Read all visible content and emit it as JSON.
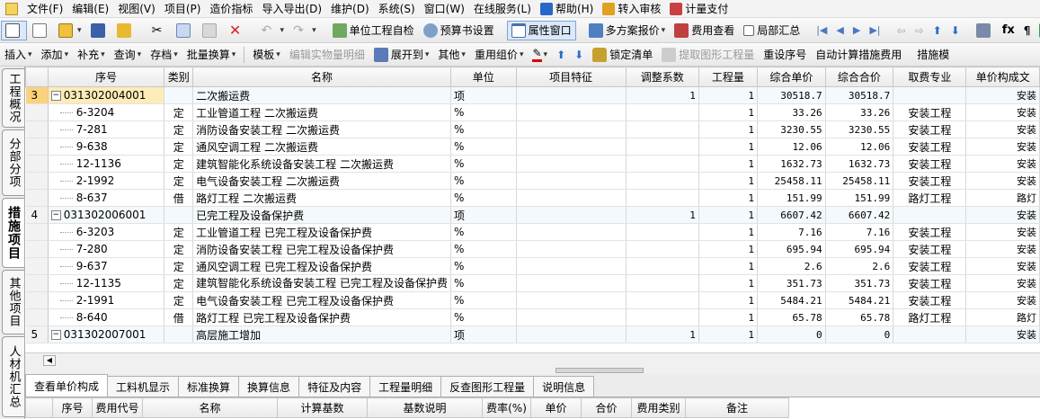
{
  "menu": [
    {
      "label": "文件(F)"
    },
    {
      "label": "编辑(E)"
    },
    {
      "label": "视图(V)"
    },
    {
      "label": "项目(P)"
    },
    {
      "label": "造价指标"
    },
    {
      "label": "导入导出(D)"
    },
    {
      "label": "维护(D)"
    },
    {
      "label": "系统(S)"
    },
    {
      "label": "窗口(W)"
    },
    {
      "label": "在线服务(L)"
    },
    {
      "label": "帮助(H)",
      "icon": "help-icon"
    },
    {
      "label": "转入审核",
      "icon": "audit-icon"
    },
    {
      "label": "计量支付",
      "icon": "pay-icon"
    }
  ],
  "toolbar1": {
    "self_check": "单位工程自检",
    "budget_settings": "预算书设置",
    "property_window": "属性窗口",
    "multi_quote": "多方案报价",
    "fee_view": "费用查看",
    "local_summary": "局部汇总"
  },
  "toolbar2": {
    "insert": "插入",
    "add": "添加",
    "supplement": "补充",
    "query": "查询",
    "archive": "存档",
    "batch_convert": "批量换算",
    "template": "模板",
    "edit_quantity_detail": "编辑实物量明细",
    "expand_to": "展开到",
    "other": "其他",
    "reuse_price": "重用组价",
    "lock_list": "锁定清单",
    "extract_graphic": "提取图形工程量",
    "reset_seq": "重设序号",
    "auto_calc_measure": "自动计算措施费用",
    "measure_template": "措施模"
  },
  "left_tabs": [
    "工程概况",
    "分部分项",
    "措施项目",
    "其他项目",
    "人材机汇总"
  ],
  "grid": {
    "columns": [
      "序号",
      "类别",
      "名称",
      "单位",
      "项目特征",
      "调整系数",
      "工程量",
      "综合单价",
      "综合合价",
      "取费专业",
      "单价构成文"
    ],
    "rows": [
      {
        "rn": "3",
        "code": "031302004001",
        "cat": "",
        "name": "二次搬运费",
        "unit": "项",
        "feature": "",
        "coef": "1",
        "qty": "1",
        "uprice": "30518.7",
        "total": "30518.7",
        "spec": "",
        "comp": "安装",
        "head": true,
        "sel": true
      },
      {
        "rn": "",
        "code": "6-3204",
        "cat": "定",
        "name": "工业管道工程 二次搬运费",
        "unit": "%",
        "feature": "",
        "coef": "",
        "qty": "1",
        "uprice": "33.26",
        "total": "33.26",
        "spec": "安装工程",
        "comp": "安装"
      },
      {
        "rn": "",
        "code": "7-281",
        "cat": "定",
        "name": "消防设备安装工程 二次搬运费",
        "unit": "%",
        "feature": "",
        "coef": "",
        "qty": "1",
        "uprice": "3230.55",
        "total": "3230.55",
        "spec": "安装工程",
        "comp": "安装"
      },
      {
        "rn": "",
        "code": "9-638",
        "cat": "定",
        "name": "通风空调工程 二次搬运费",
        "unit": "%",
        "feature": "",
        "coef": "",
        "qty": "1",
        "uprice": "12.06",
        "total": "12.06",
        "spec": "安装工程",
        "comp": "安装"
      },
      {
        "rn": "",
        "code": "12-1136",
        "cat": "定",
        "name": "建筑智能化系统设备安装工程 二次搬运费",
        "unit": "%",
        "feature": "",
        "coef": "",
        "qty": "1",
        "uprice": "1632.73",
        "total": "1632.73",
        "spec": "安装工程",
        "comp": "安装"
      },
      {
        "rn": "",
        "code": "2-1992",
        "cat": "定",
        "name": "电气设备安装工程 二次搬运费",
        "unit": "%",
        "feature": "",
        "coef": "",
        "qty": "1",
        "uprice": "25458.11",
        "total": "25458.11",
        "spec": "安装工程",
        "comp": "安装"
      },
      {
        "rn": "",
        "code": "8-637",
        "cat": "借",
        "name": "路灯工程 二次搬运费",
        "unit": "%",
        "feature": "",
        "coef": "",
        "qty": "1",
        "uprice": "151.99",
        "total": "151.99",
        "spec": "路灯工程",
        "comp": "路灯"
      },
      {
        "rn": "4",
        "code": "031302006001",
        "cat": "",
        "name": "已完工程及设备保护费",
        "unit": "项",
        "feature": "",
        "coef": "1",
        "qty": "1",
        "uprice": "6607.42",
        "total": "6607.42",
        "spec": "",
        "comp": "安装",
        "head": true
      },
      {
        "rn": "",
        "code": "6-3203",
        "cat": "定",
        "name": "工业管道工程 已完工程及设备保护费",
        "unit": "%",
        "feature": "",
        "coef": "",
        "qty": "1",
        "uprice": "7.16",
        "total": "7.16",
        "spec": "安装工程",
        "comp": "安装"
      },
      {
        "rn": "",
        "code": "7-280",
        "cat": "定",
        "name": "消防设备安装工程 已完工程及设备保护费",
        "unit": "%",
        "feature": "",
        "coef": "",
        "qty": "1",
        "uprice": "695.94",
        "total": "695.94",
        "spec": "安装工程",
        "comp": "安装"
      },
      {
        "rn": "",
        "code": "9-637",
        "cat": "定",
        "name": "通风空调工程 已完工程及设备保护费",
        "unit": "%",
        "feature": "",
        "coef": "",
        "qty": "1",
        "uprice": "2.6",
        "total": "2.6",
        "spec": "安装工程",
        "comp": "安装"
      },
      {
        "rn": "",
        "code": "12-1135",
        "cat": "定",
        "name": "建筑智能化系统设备安装工程 已完工程及设备保护费",
        "unit": "%",
        "feature": "",
        "coef": "",
        "qty": "1",
        "uprice": "351.73",
        "total": "351.73",
        "spec": "安装工程",
        "comp": "安装",
        "wrap": true
      },
      {
        "rn": "",
        "code": "2-1991",
        "cat": "定",
        "name": "电气设备安装工程 已完工程及设备保护费",
        "unit": "%",
        "feature": "",
        "coef": "",
        "qty": "1",
        "uprice": "5484.21",
        "total": "5484.21",
        "spec": "安装工程",
        "comp": "安装"
      },
      {
        "rn": "",
        "code": "8-640",
        "cat": "借",
        "name": "路灯工程 已完工程及设备保护费",
        "unit": "%",
        "feature": "",
        "coef": "",
        "qty": "1",
        "uprice": "65.78",
        "total": "65.78",
        "spec": "路灯工程",
        "comp": "路灯"
      },
      {
        "rn": "5",
        "code": "031302007001",
        "cat": "",
        "name": "高层施工增加",
        "unit": "项",
        "feature": "",
        "coef": "1",
        "qty": "1",
        "uprice": "0",
        "total": "0",
        "spec": "",
        "comp": "安装",
        "head": true
      }
    ]
  },
  "bottom_tabs": [
    "查看单价构成",
    "工料机显示",
    "标准换算",
    "换算信息",
    "特征及内容",
    "工程量明细",
    "反查图形工程量",
    "说明信息"
  ],
  "bottom_grid": {
    "columns": [
      "序号",
      "费用代号",
      "名称",
      "计算基数",
      "基数说明",
      "费率(%)",
      "单价",
      "合价",
      "费用类别",
      "备注"
    ]
  },
  "colors": {
    "selected_row_number": "#fbd27c",
    "selected_code_cell": "#fdebb8",
    "list_row_bg": "#f4f9fd",
    "active_tool": "#dbe8f8"
  }
}
